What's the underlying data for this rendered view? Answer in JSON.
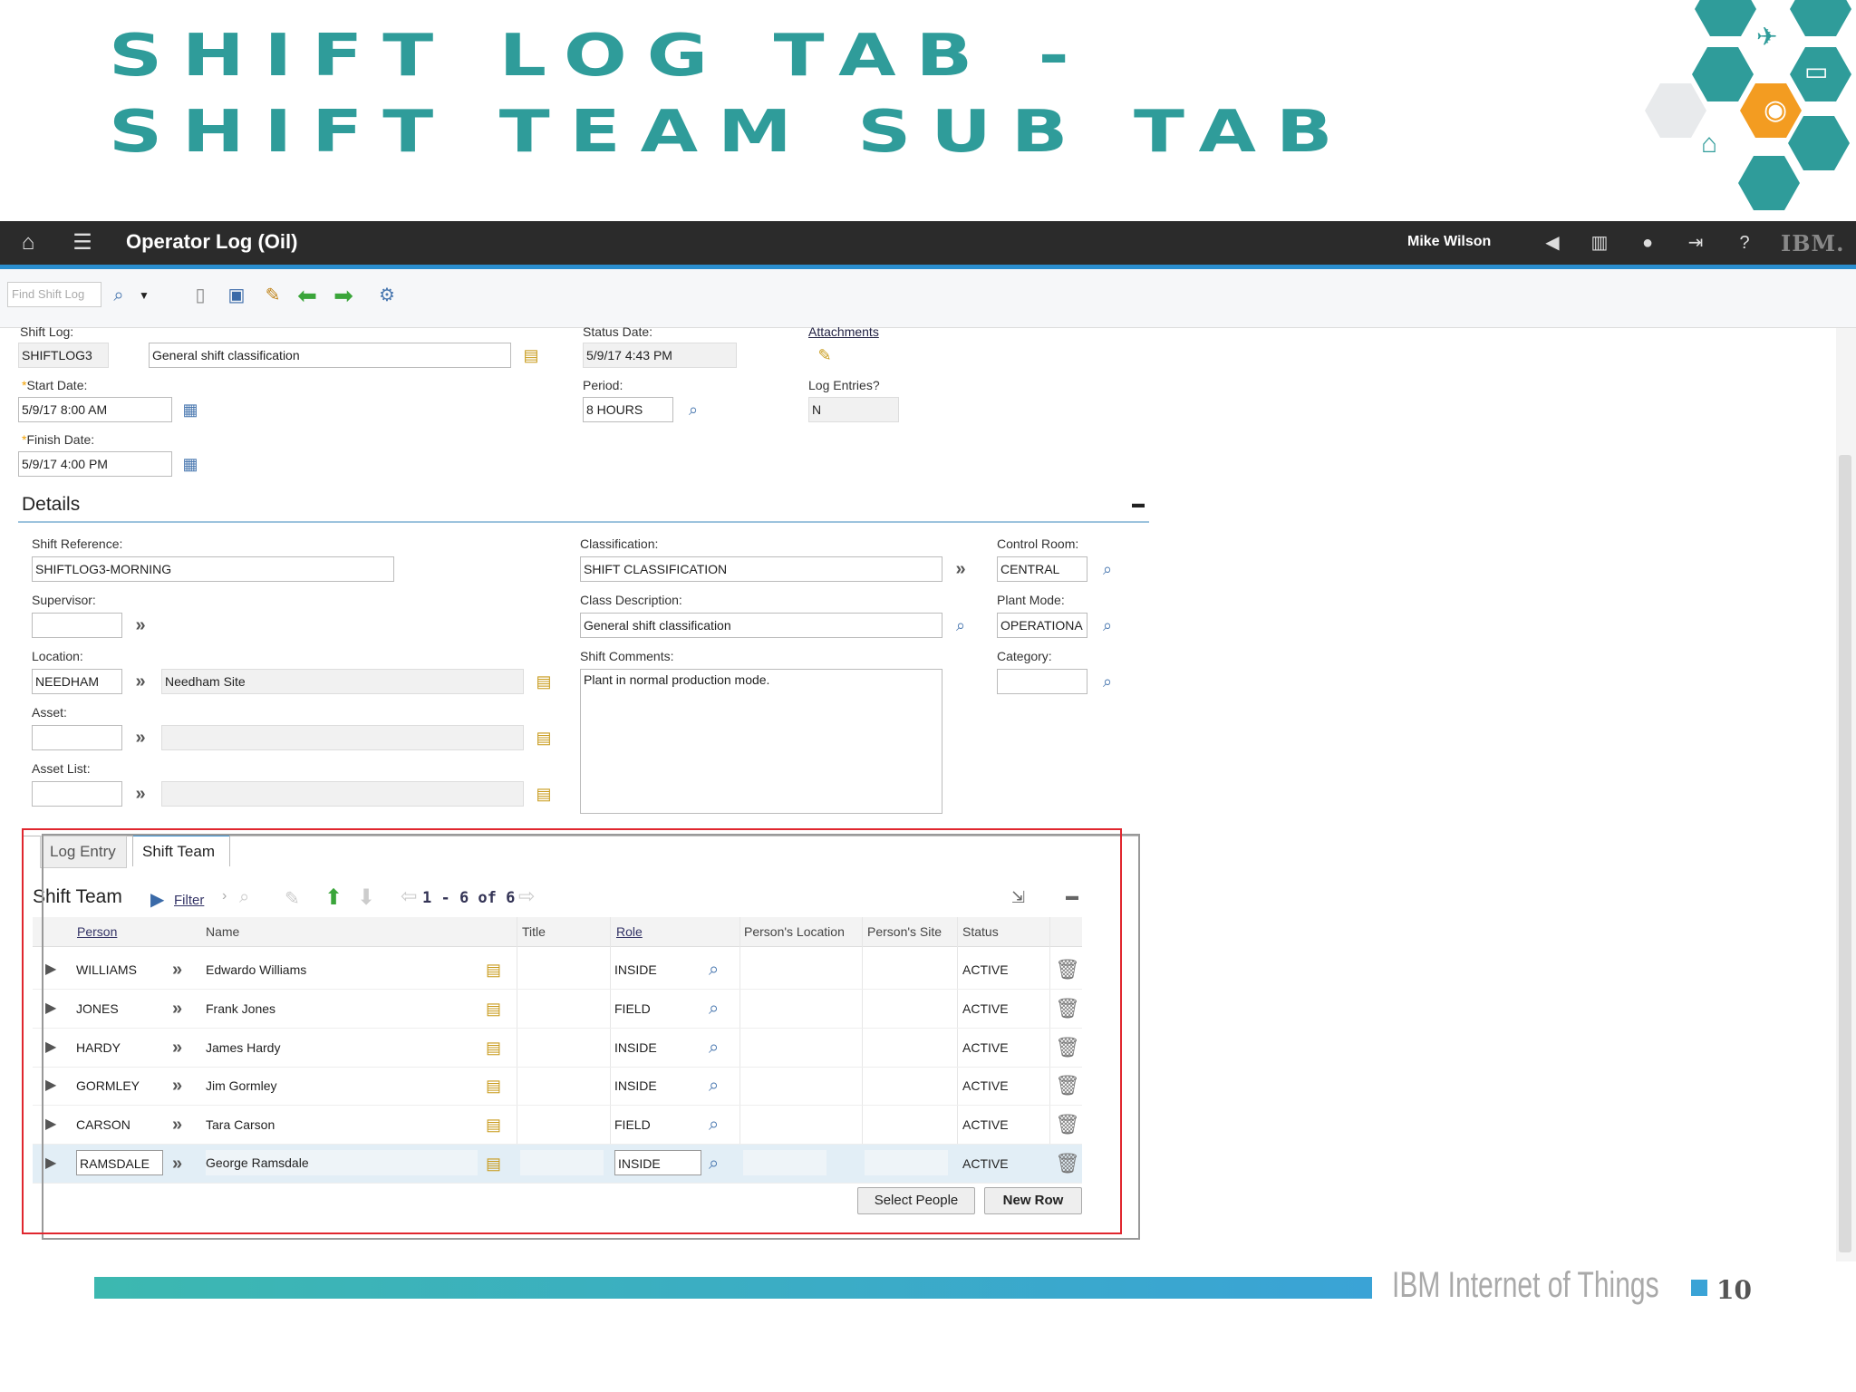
{
  "slide": {
    "title_line1": "SHIFT LOG TAB -",
    "title_line2": "SHIFT TEAM SUB TAB",
    "footer_brand": "IBM Internet of Things",
    "page_number": "10"
  },
  "header": {
    "app_title": "Operator Log (Oil)",
    "user_name": "Mike Wilson",
    "logo": "IBM."
  },
  "toolbar": {
    "find_placeholder": "Find Shift Log"
  },
  "form": {
    "shift_log_label": "Shift Log:",
    "shift_log_value": "SHIFTLOG3",
    "shift_log_desc": "General shift classification",
    "status_date_label": "Status Date:",
    "status_date_value": "5/9/17 4:43 PM",
    "attachments_label": "Attachments",
    "start_date_label": "Start Date:",
    "start_date_value": "5/9/17 8:00 AM",
    "period_label": "Period:",
    "period_value": "8 HOURS",
    "log_entries_label": "Log Entries?",
    "log_entries_value": "N",
    "finish_date_label": "Finish Date:",
    "finish_date_value": "5/9/17 4:00 PM"
  },
  "details": {
    "title": "Details",
    "shift_reference_label": "Shift Reference:",
    "shift_reference_value": "SHIFTLOG3-MORNING",
    "classification_label": "Classification:",
    "classification_value": "SHIFT CLASSIFICATION",
    "control_room_label": "Control Room:",
    "control_room_value": "CENTRAL",
    "supervisor_label": "Supervisor:",
    "supervisor_value": "",
    "class_description_label": "Class Description:",
    "class_description_value": "General shift classification",
    "plant_mode_label": "Plant Mode:",
    "plant_mode_value": "OPERATIONA",
    "location_label": "Location:",
    "location_value": "NEEDHAM",
    "location_desc": "Needham Site",
    "shift_comments_label": "Shift Comments:",
    "shift_comments_value": "Plant in normal production mode.",
    "category_label": "Category:",
    "category_value": "",
    "asset_label": "Asset:",
    "asset_list_label": "Asset List:"
  },
  "tabs": [
    {
      "label": "Log Entry"
    },
    {
      "label": "Shift Team"
    }
  ],
  "team_table": {
    "title": "Shift Team",
    "filter_label": "Filter",
    "pagination": "1 - 6 of 6",
    "columns": [
      "Person",
      "Name",
      "Title",
      "Role",
      "Person's Location",
      "Person's Site",
      "Status"
    ],
    "rows": [
      {
        "person": "WILLIAMS",
        "name": "Edwardo Williams",
        "title": "",
        "role": "INSIDE",
        "status": "ACTIVE"
      },
      {
        "person": "JONES",
        "name": "Frank Jones",
        "title": "",
        "role": "FIELD",
        "status": "ACTIVE"
      },
      {
        "person": "HARDY",
        "name": "James Hardy",
        "title": "",
        "role": "INSIDE",
        "status": "ACTIVE"
      },
      {
        "person": "GORMLEY",
        "name": "Jim Gormley",
        "title": "",
        "role": "INSIDE",
        "status": "ACTIVE"
      },
      {
        "person": "CARSON",
        "name": "Tara Carson",
        "title": "",
        "role": "FIELD",
        "status": "ACTIVE"
      },
      {
        "person": "RAMSDALE",
        "name": "George Ramsdale",
        "title": "",
        "role": "INSIDE",
        "status": "ACTIVE"
      }
    ],
    "select_people_label": "Select People",
    "new_row_label": "New Row"
  },
  "colors": {
    "title_teal": "#2f9c9a",
    "header_bg": "#2b2b2b",
    "header_accent": "#2a8ecf",
    "highlight_red": "#e0262e",
    "hex_orange": "#f39c21"
  }
}
